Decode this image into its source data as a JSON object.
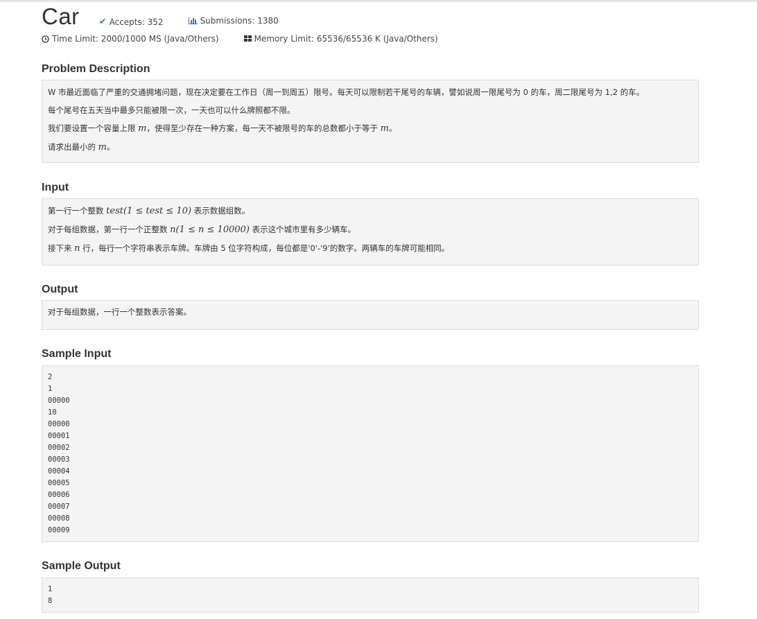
{
  "title": "Car",
  "accepts": "Accepts: 352",
  "submissions": "Submissions: 1380",
  "time_limit": "Time Limit: 2000/1000 MS (Java/Others)",
  "memory_limit": "Memory Limit: 65536/65536 K (Java/Others)",
  "icons": {
    "accepts": "check-icon",
    "submissions": "bar-chart-icon",
    "time": "clock-icon",
    "memory": "grid-icon"
  },
  "colors": {
    "check": "#2e9c3b",
    "link_icon": "#4a6fa5",
    "panel_bg": "#f4f4f4",
    "panel_border": "#dcdcdc"
  },
  "description": {
    "heading": "Problem Description",
    "line1": "W 市最近面临了严重的交通拥堵问题，现在决定要在工作日（周一到周五）限号。每天可以限制若干尾号的车辆，譬如说周一限尾号为 0 的车，周二限尾号为 1,2 的车。",
    "line2": "每个尾号在五天当中最多只能被限一次，一天也可以什么牌照都不限。",
    "line3_a": "我们要设置一个容量上限 ",
    "line3_m": "m",
    "line3_b": "，使得至少存在一种方案，每一天不被限号的车的总数都小于等于 ",
    "line3_m2": "m",
    "line3_c": "。",
    "line4_a": "请求出最小的 ",
    "line4_m": "m",
    "line4_b": "。"
  },
  "input": {
    "heading": "Input",
    "line1_a": "第一行一个整数 ",
    "line1_math": "test(1 ≤ test ≤ 10)",
    "line1_b": " 表示数据组数。",
    "line2_a": "对于每组数据，第一行一个正整数 ",
    "line2_math": "n(1 ≤ n ≤ 10000)",
    "line2_b": " 表示这个城市里有多少辆车。",
    "line3_a": "接下来 ",
    "line3_n": "n",
    "line3_b": " 行，每行一个字符串表示车牌。车牌由 5 位字符构成，每位都是'0'-'9'的数字。两辆车的车牌可能相同。"
  },
  "output": {
    "heading": "Output",
    "line1": "对于每组数据，一行一个整数表示答案。"
  },
  "sample_input": {
    "heading": "Sample Input",
    "lines": [
      "2",
      "1",
      "00000",
      "10",
      "00000",
      "00001",
      "00002",
      "00003",
      "00004",
      "00005",
      "00006",
      "00007",
      "00008",
      "00009"
    ]
  },
  "sample_output": {
    "heading": "Sample Output",
    "lines": [
      "1",
      "8"
    ]
  }
}
